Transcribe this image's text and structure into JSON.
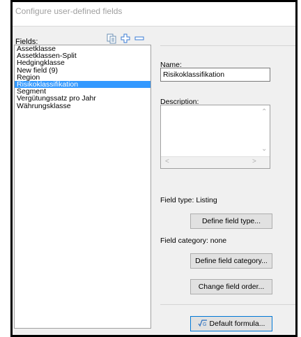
{
  "window": {
    "title": "Configure user-defined fields"
  },
  "fields": {
    "label": "Fields:",
    "toolbar": {
      "copy_icon": "copy-icon",
      "add_icon": "plus-icon",
      "remove_icon": "minus-icon"
    },
    "items": [
      "Assetklasse",
      "Assetklassen-Split",
      "Hedgingklasse",
      "New field (9)",
      "Region",
      "Risikoklassifikation",
      "Segment",
      "Vergütungssatz pro Jahr",
      "Währungsklasse"
    ],
    "selected_index": 5
  },
  "details": {
    "name_label": "Name:",
    "name_value": "Risikoklassifikation",
    "description_label": "Description:",
    "description_value": "",
    "field_type_label": "Field type: Listing",
    "define_field_type_button": "Define field type...",
    "field_category_label": "Field category:  none",
    "define_field_category_button": "Define field category...",
    "change_field_order_button": "Change field order...",
    "default_formula_button": "Default formula...",
    "default_formula_icon": "formula-icon"
  },
  "colors": {
    "selection": "#3399ff",
    "button_focus_border": "#0078d7"
  }
}
